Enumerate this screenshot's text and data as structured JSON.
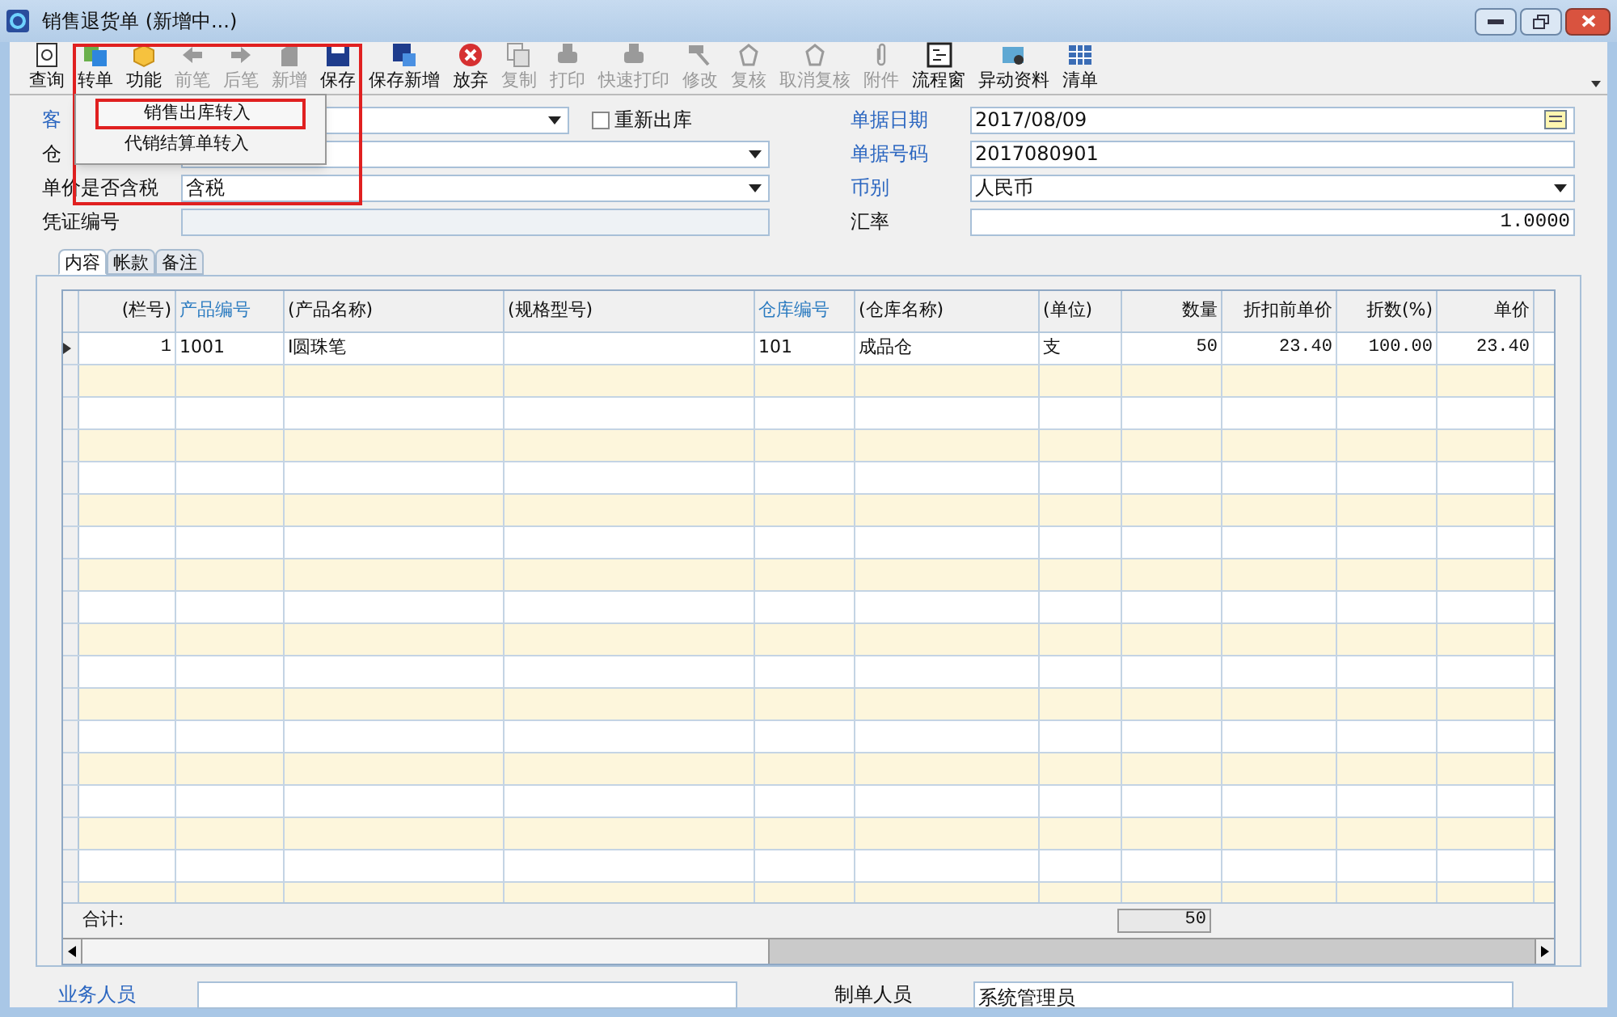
{
  "window": {
    "title": "销售退货单 (新增中...)"
  },
  "toolbar": [
    {
      "label": "查询",
      "disabled": false
    },
    {
      "label": "转单",
      "disabled": false
    },
    {
      "label": "功能",
      "disabled": false
    },
    {
      "label": "前笔",
      "disabled": true
    },
    {
      "label": "后笔",
      "disabled": true
    },
    {
      "label": "新增",
      "disabled": true
    },
    {
      "label": "保存",
      "disabled": false
    },
    {
      "label": "保存新增",
      "disabled": false
    },
    {
      "label": "放弃",
      "disabled": false
    },
    {
      "label": "复制",
      "disabled": true
    },
    {
      "label": "打印",
      "disabled": true
    },
    {
      "label": "快速打印",
      "disabled": true
    },
    {
      "label": "修改",
      "disabled": true
    },
    {
      "label": "复核",
      "disabled": true
    },
    {
      "label": "取消复核",
      "disabled": true
    },
    {
      "label": "附件",
      "disabled": true
    },
    {
      "label": "流程窗",
      "disabled": false
    },
    {
      "label": "异动资料",
      "disabled": false
    },
    {
      "label": "清单",
      "disabled": false
    }
  ],
  "menu": {
    "items": [
      {
        "label": "销售出库转入",
        "selected": true
      },
      {
        "label": "代销结算单转入",
        "selected": false
      }
    ]
  },
  "form_left": [
    {
      "label": "客",
      "kind": "dropdown",
      "link": true,
      "checkbox": {
        "label": "重新出库",
        "checked": false
      }
    },
    {
      "label": "仓",
      "kind": "dropdown",
      "link": false
    },
    {
      "label": "单价是否含税",
      "kind": "dropdown",
      "value": "含税",
      "link": false
    },
    {
      "label": "凭证编号",
      "kind": "readonly",
      "link": false
    }
  ],
  "form_right": [
    {
      "label": "单据日期",
      "kind": "date",
      "value": "2017/08/09",
      "link": true
    },
    {
      "label": "单据号码",
      "kind": "text",
      "value": "2017080901",
      "link": true
    },
    {
      "label": "币别",
      "kind": "dropdown",
      "value": "人民币",
      "link": true
    },
    {
      "label": "汇率",
      "kind": "number",
      "value": "1.0000",
      "link": false
    }
  ],
  "tabs": [
    {
      "label": "内容",
      "selected": true
    },
    {
      "label": "帐款",
      "selected": false
    },
    {
      "label": "备注",
      "selected": false
    }
  ],
  "table": {
    "columns": [
      {
        "label": "(栏号)",
        "link": false
      },
      {
        "label": "产品编号",
        "link": true
      },
      {
        "label": "(产品名称)",
        "link": false
      },
      {
        "label": "(规格型号)",
        "link": false
      },
      {
        "label": "仓库编号",
        "link": true
      },
      {
        "label": "(仓库名称)",
        "link": false
      },
      {
        "label": "(单位)",
        "link": false
      },
      {
        "label": "数量",
        "link": false
      },
      {
        "label": "折扣前单价",
        "link": false
      },
      {
        "label": "折数(%)",
        "link": false
      },
      {
        "label": "单价",
        "link": false
      }
    ],
    "rows": [
      {
        "current": true,
        "cells": [
          "1",
          "1001",
          "I圆珠笔",
          "",
          "101",
          "成品仓",
          "支",
          "50",
          "23.40",
          "100.00",
          "23.40"
        ]
      }
    ],
    "total_label": "合计:",
    "total_quantity": "50"
  },
  "bottom": [
    {
      "label": "业务人员",
      "link": true
    },
    {
      "label": "制单人员",
      "value": "系统管理员",
      "link": false
    }
  ]
}
